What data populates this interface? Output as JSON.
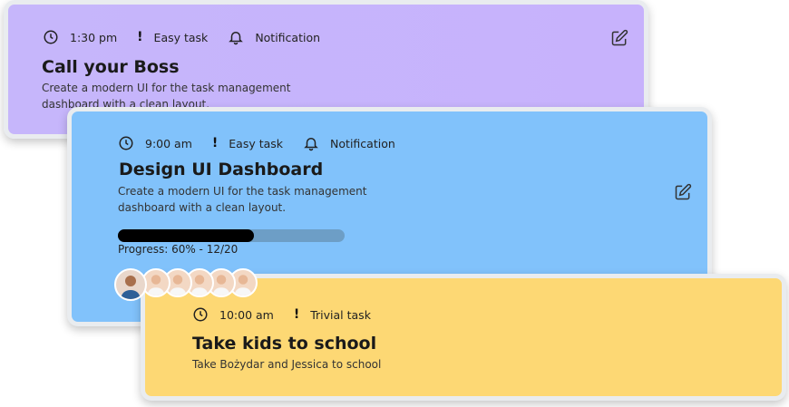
{
  "cards": [
    {
      "time": "1:30 pm",
      "priority": "Easy task",
      "notification": "Notification",
      "title": "Call your Boss",
      "description_line1": "Create a modern UI for the task management",
      "description_line2": "dashboard with a clean layout.",
      "color": "#c7b5fb"
    },
    {
      "time": "9:00 am",
      "priority": "Easy task",
      "notification": "Notification",
      "title": "Design UI Dashboard",
      "description_line1": "Create a modern UI for the task management",
      "description_line2": "dashboard with a clean layout.",
      "progress_percent": 60,
      "progress_label": "Progress: 60% - 12/20",
      "color": "#81c2fb",
      "avatar_count": 6
    },
    {
      "time": "10:00 am",
      "priority": "Trivial task",
      "title": "Take kids to school",
      "description": "Take Bożydar and Jessica to school",
      "color": "#fdd874"
    }
  ],
  "icons": {
    "clock": "clock-icon",
    "priority": "exclamation-icon",
    "bell": "bell-icon",
    "edit": "edit-icon"
  }
}
